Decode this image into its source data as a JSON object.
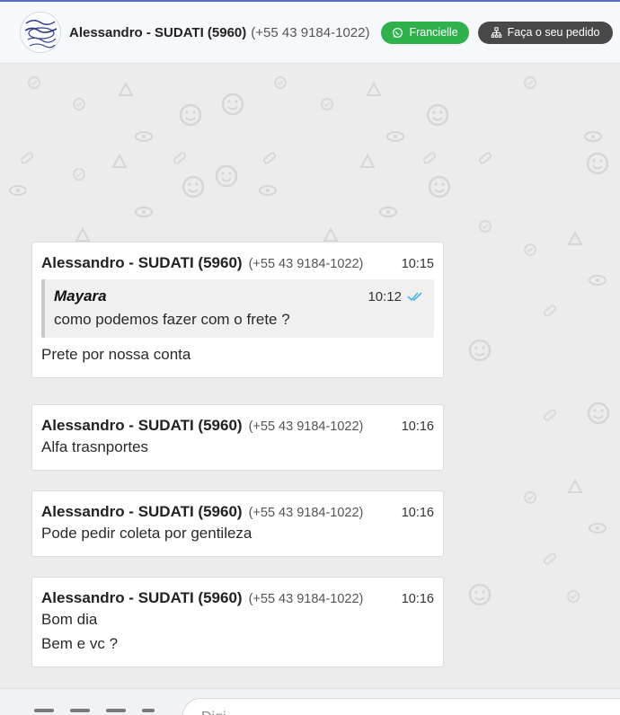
{
  "header": {
    "contact_name": "Alessandro - SUDATI (5960)",
    "contact_phone": "(+55 43 9184-1022)",
    "agent_button": "Francielle",
    "order_button": "Faça o seu pedido"
  },
  "colors": {
    "green": "#2fb24c",
    "dark": "#484848",
    "accent": "#5b6cc9",
    "read_check": "#4fb6e8"
  },
  "messages": [
    {
      "sender": "Alessandro - SUDATI (5960)",
      "phone": "(+55 43 9184-1022)",
      "time": "10:15",
      "quote": {
        "author": "Mayara",
        "time": "10:12",
        "text": "como podemos fazer com o frete ?"
      },
      "lines": [
        "Prete por nossa conta"
      ]
    },
    {
      "sender": "Alessandro - SUDATI (5960)",
      "phone": "(+55 43 9184-1022)",
      "time": "10:16",
      "lines": [
        "Alfa trasnportes"
      ]
    },
    {
      "sender": "Alessandro - SUDATI (5960)",
      "phone": "(+55 43 9184-1022)",
      "time": "10:16",
      "lines": [
        "Pode pedir coleta por gentileza"
      ]
    },
    {
      "sender": "Alessandro - SUDATI (5960)",
      "phone": "(+55 43 9184-1022)",
      "time": "10:16",
      "lines": [
        "Bom dia",
        "Bem e vc ?"
      ]
    }
  ],
  "composer": {
    "value": "Digi"
  }
}
